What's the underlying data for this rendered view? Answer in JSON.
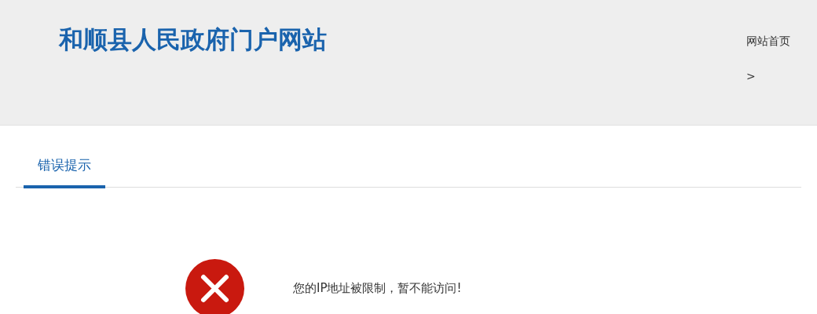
{
  "site_title": "和顺县人民政府门户网站",
  "nav_links": [
    {
      "label": "网站首页"
    },
    {
      "label": ">"
    }
  ],
  "tabs": [
    {
      "label": "错误提示",
      "selected": true
    }
  ],
  "error": {
    "message": "您的IP地址被限制，暂不能访问!"
  }
}
